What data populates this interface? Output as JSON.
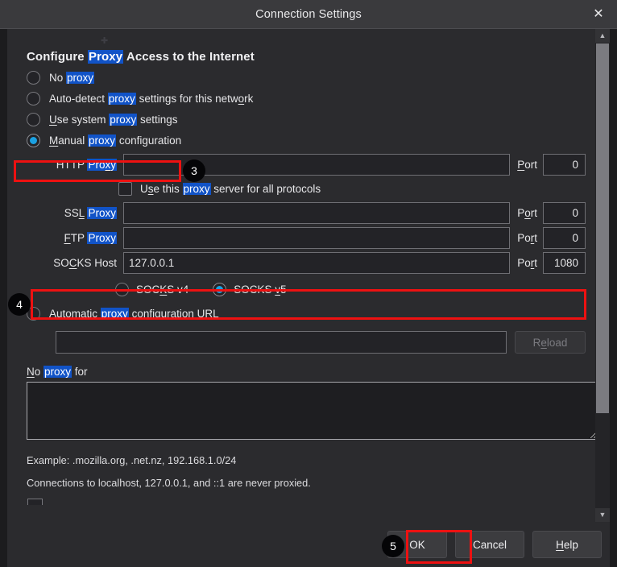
{
  "window": {
    "title": "Connection Settings",
    "close_icon": "close-icon"
  },
  "section": {
    "title_pre": "Configure ",
    "title_hl": "Proxy",
    "title_post": " Access to the Internet"
  },
  "proxy_modes": [
    {
      "id": "no-proxy",
      "pre": "No ",
      "hl": "proxy",
      "post": "",
      "accesskey": "",
      "selected": false
    },
    {
      "id": "auto-detect",
      "pre": "Auto-detect ",
      "hl": "proxy",
      "post": " settings for this network",
      "accesskey": "o",
      "selected": false
    },
    {
      "id": "use-system",
      "pre": "Use system ",
      "hl": "proxy",
      "post": " settings",
      "accesskey": "U",
      "selected": false
    },
    {
      "id": "manual",
      "pre": "Manual ",
      "hl": "proxy",
      "post": " configuration",
      "accesskey": "M",
      "selected": true
    }
  ],
  "fields": {
    "http": {
      "label_pre": "HTTP ",
      "label_hl": "Proxy",
      "value": "",
      "placeholder": "",
      "port_label": "Port",
      "port_value": "0"
    },
    "use_for_all": {
      "pre": "Use this ",
      "hl": "proxy",
      "post": " server for all protocols",
      "checked": false
    },
    "ssl": {
      "label_pre": "SSL ",
      "label_hl": "Proxy",
      "value": "",
      "placeholder": "",
      "port_label": "Port",
      "port_value": "0"
    },
    "ftp": {
      "label_pre": "FTP ",
      "label_hl": "Proxy",
      "value": "",
      "placeholder": "",
      "port_label": "Port",
      "port_value": "0"
    },
    "socks": {
      "label": "SOCKS Host",
      "value": "127.0.0.1",
      "placeholder": "",
      "port_label": "Port",
      "port_value": "1080"
    }
  },
  "socks_versions": [
    {
      "id": "v4",
      "label": "SOCKS v4",
      "selected": false
    },
    {
      "id": "v5",
      "label": "SOCKS v5",
      "selected": true
    }
  ],
  "pac": {
    "pre": "Automatic ",
    "hl": "proxy",
    "post": " configuration URL",
    "selected": false,
    "url_value": "",
    "url_placeholder": "",
    "reload_label": "Reload",
    "reload_disabled": true
  },
  "no_proxy": {
    "label_pre": "No ",
    "label_hl": "proxy",
    "label_post": " for",
    "value": "",
    "placeholder": "",
    "hint1": "Example: .mozilla.org, .net.nz, 192.168.1.0/24",
    "hint2": "Connections to localhost, 127.0.0.1, and ::1 are never proxied."
  },
  "footer": {
    "ok": "OK",
    "cancel": "Cancel",
    "help": "Help"
  },
  "scrollbar": {
    "up_icon": "chevron-up-icon",
    "down_icon": "chevron-down-icon"
  },
  "annotations": {
    "badge3": "3",
    "badge4": "4",
    "badge5": "5",
    "highlight_color": "#ee1111",
    "badge_color": "#050507"
  },
  "colors": {
    "accent": "#1ba1e2",
    "search_highlight": "#1153c7",
    "window_bg": "#2b2b2e",
    "titlebar_bg": "#3a3a3d"
  }
}
